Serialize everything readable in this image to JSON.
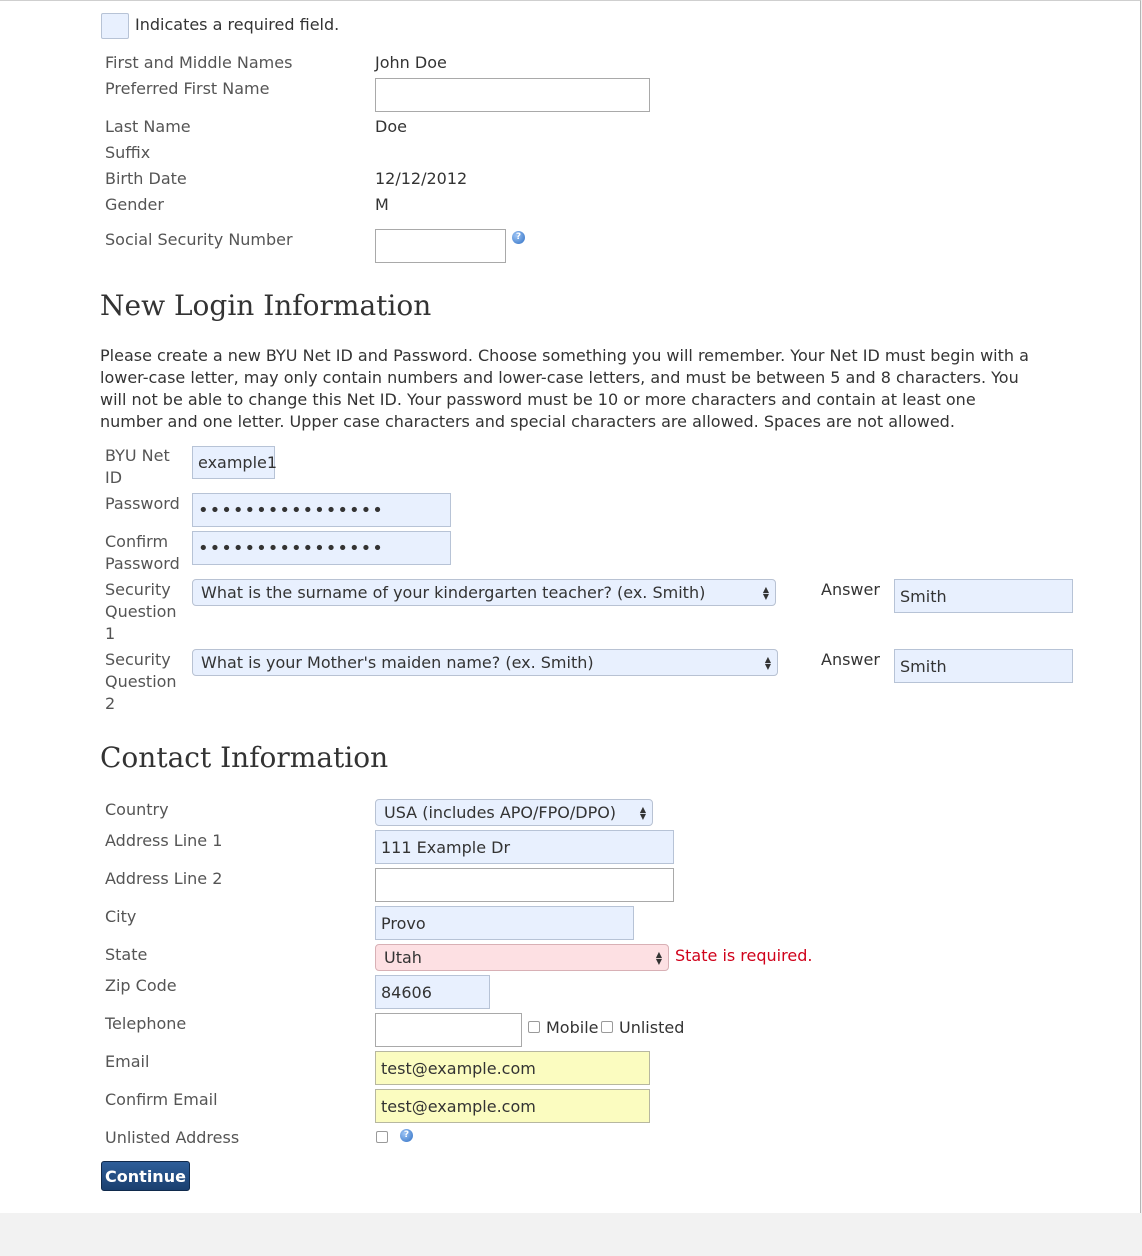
{
  "legend": {
    "text": "Indicates a required field."
  },
  "personal": {
    "first_middle_label": "First and Middle Names",
    "first_middle_value": "John Doe",
    "preferred_label": "Preferred First Name",
    "preferred_value": "",
    "last_label": "Last Name",
    "last_value": "Doe",
    "suffix_label": "Suffix",
    "birth_label": "Birth Date",
    "birth_value": "12/12/2012",
    "gender_label": "Gender",
    "gender_value": "M",
    "ssn_label": "Social Security Number",
    "ssn_value": ""
  },
  "login": {
    "heading": "New Login Information",
    "instructions": "Please create a new BYU Net ID and Password. Choose something you will remember. Your Net ID must begin with a lower-case letter, may only contain numbers and lower-case letters, and must be between 5 and 8 characters. You will not be able to change this Net ID. Your password must be 10 or more characters and contain at least one number and one letter. Upper case characters and special characters are allowed. Spaces are not allowed.",
    "netid_label": "BYU Net ID",
    "netid_value": "example1",
    "password_label": "Password",
    "password_value": "••••••••••••••••",
    "confirm_label": "Confirm Password",
    "confirm_value": "••••••••••••••••",
    "q1_label": "Security Question 1",
    "q1_value": "What is the surname of your kindergarten teacher? (ex. Smith)",
    "q2_label": "Security Question 2",
    "q2_value": "What is your Mother's maiden name? (ex. Smith)",
    "answer_label": "Answer",
    "a1_value": "Smith",
    "a2_value": "Smith"
  },
  "contact": {
    "heading": "Contact Information",
    "country_label": "Country",
    "country_value": "USA (includes APO/FPO/DPO)",
    "addr1_label": "Address Line 1",
    "addr1_value": "111 Example Dr",
    "addr2_label": "Address Line 2",
    "addr2_value": "",
    "city_label": "City",
    "city_value": "Provo",
    "state_label": "State",
    "state_value": "Utah",
    "state_error": "State is required.",
    "zip_label": "Zip Code",
    "zip_value": "84606",
    "phone_label": "Telephone",
    "phone_value": "",
    "mobile_label": "Mobile",
    "unlisted_label": "Unlisted",
    "email_label": "Email",
    "email_value": "test@example.com",
    "confirm_email_label": "Confirm Email",
    "confirm_email_value": "test@example.com",
    "unlisted_address_label": "Unlisted Address"
  },
  "actions": {
    "continue_label": "Continue"
  },
  "colors": {
    "required_bg": "#e8f0fe",
    "autofill_bg": "#fbfcc0",
    "error_bg": "#fde0e3",
    "error_text": "#d0021b",
    "button_bg": "#1f4a80"
  }
}
